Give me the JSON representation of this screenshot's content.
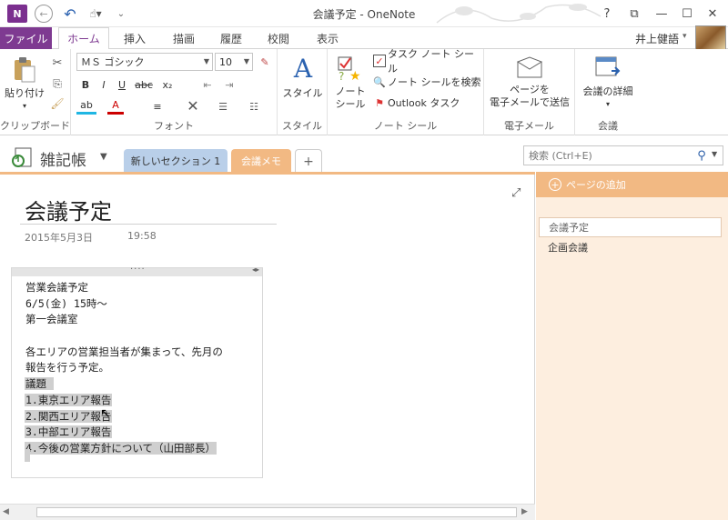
{
  "window": {
    "title": "会議予定 - OneNote",
    "app_logo": "N",
    "help": "?",
    "ribbon_display": "⧉",
    "minimize": "—",
    "maximize": "☐",
    "close": "✕"
  },
  "quick_access": {
    "back": "←",
    "undo": "↶",
    "touch": "☝▾",
    "more": "⌄"
  },
  "tabs": {
    "file": "ファイル",
    "items": [
      "ホーム",
      "挿入",
      "描画",
      "履歴",
      "校閲",
      "表示"
    ],
    "active": "ホーム"
  },
  "user": {
    "name": "井上健語",
    "caret": "▾"
  },
  "ribbon": {
    "clipboard": {
      "label": "クリップボード",
      "paste": "貼り付け",
      "paste_caret": "▾"
    },
    "font": {
      "label": "フォント",
      "font_name": "ＭＳ ゴシック",
      "font_size": "10",
      "bold": "B",
      "italic": "I",
      "underline": "U",
      "strike": "abc",
      "subscript": "x₂",
      "highlight": "ab",
      "font_color": "A",
      "align": "≡",
      "clear": "✕"
    },
    "style": {
      "label": "スタイル",
      "button": "スタイル"
    },
    "tags": {
      "label": "ノート シール",
      "notes_line1": "ノート",
      "notes_line2": "シール",
      "task_tag": "タスク ノート シール",
      "find_tags": "ノート シールを検索",
      "outlook_task": "Outlook タスク"
    },
    "email": {
      "label": "電子メール",
      "line1": "ページを",
      "line2": "電子メールで送信"
    },
    "meetings": {
      "label": "会議",
      "button": "会議の詳細"
    }
  },
  "notebook": {
    "name": "雑記帳",
    "sections": [
      "新しいセクション 1",
      "会議メモ"
    ],
    "add_section": "+"
  },
  "search": {
    "placeholder": "検索 (Ctrl+E)"
  },
  "page": {
    "title": "会議予定",
    "date": "2015年5月3日",
    "time": "19:58",
    "lines": [
      {
        "text": "営業会議予定",
        "selected": false
      },
      {
        "text": "6/5(金) 15時～",
        "selected": false
      },
      {
        "text": "第一会議室",
        "selected": false
      },
      {
        "text": "",
        "selected": false
      },
      {
        "text": "各エリアの営業担当者が集まって、先月の",
        "selected": false
      },
      {
        "text": "報告を行う予定。",
        "selected": false
      },
      {
        "text": "議題 ",
        "selected": true
      },
      {
        "text": "1.東京エリア報告",
        "selected": true
      },
      {
        "text": "2.関西エリア報告",
        "selected": true
      },
      {
        "text": "3.中部エリア報告",
        "selected": true
      },
      {
        "text": "4.今後の営業方針について（山田部長）",
        "selected": true
      }
    ]
  },
  "pagelist": {
    "add_page": "ページの追加",
    "pages": [
      "会議予定",
      "企画会議"
    ],
    "active_index": 0
  },
  "colors": {
    "accent": "#7e3a91",
    "section_blue": "#b9cfe9",
    "section_orange": "#f2b983",
    "page_list_bg": "#fdeedf"
  }
}
